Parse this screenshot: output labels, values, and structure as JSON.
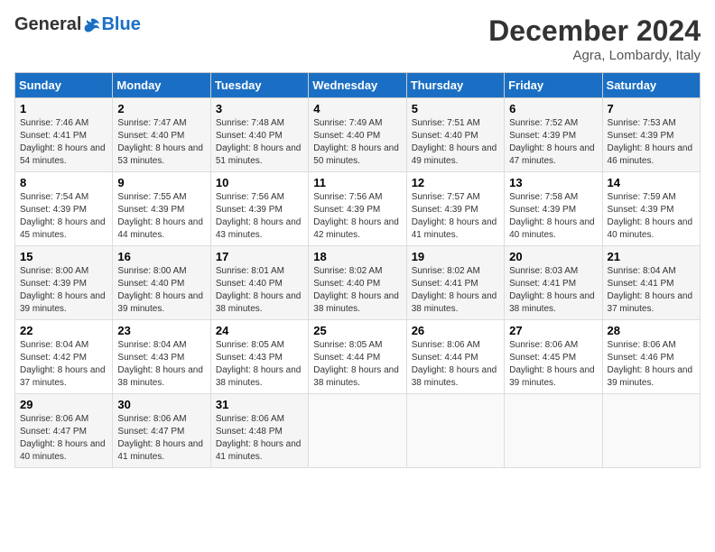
{
  "header": {
    "logo_general": "General",
    "logo_blue": "Blue",
    "month_title": "December 2024",
    "location": "Agra, Lombardy, Italy"
  },
  "days_of_week": [
    "Sunday",
    "Monday",
    "Tuesday",
    "Wednesday",
    "Thursday",
    "Friday",
    "Saturday"
  ],
  "weeks": [
    [
      {
        "day": "1",
        "sunrise": "7:46 AM",
        "sunset": "4:41 PM",
        "daylight": "8 hours and 54 minutes."
      },
      {
        "day": "2",
        "sunrise": "7:47 AM",
        "sunset": "4:40 PM",
        "daylight": "8 hours and 53 minutes."
      },
      {
        "day": "3",
        "sunrise": "7:48 AM",
        "sunset": "4:40 PM",
        "daylight": "8 hours and 51 minutes."
      },
      {
        "day": "4",
        "sunrise": "7:49 AM",
        "sunset": "4:40 PM",
        "daylight": "8 hours and 50 minutes."
      },
      {
        "day": "5",
        "sunrise": "7:51 AM",
        "sunset": "4:40 PM",
        "daylight": "8 hours and 49 minutes."
      },
      {
        "day": "6",
        "sunrise": "7:52 AM",
        "sunset": "4:39 PM",
        "daylight": "8 hours and 47 minutes."
      },
      {
        "day": "7",
        "sunrise": "7:53 AM",
        "sunset": "4:39 PM",
        "daylight": "8 hours and 46 minutes."
      }
    ],
    [
      {
        "day": "8",
        "sunrise": "7:54 AM",
        "sunset": "4:39 PM",
        "daylight": "8 hours and 45 minutes."
      },
      {
        "day": "9",
        "sunrise": "7:55 AM",
        "sunset": "4:39 PM",
        "daylight": "8 hours and 44 minutes."
      },
      {
        "day": "10",
        "sunrise": "7:56 AM",
        "sunset": "4:39 PM",
        "daylight": "8 hours and 43 minutes."
      },
      {
        "day": "11",
        "sunrise": "7:56 AM",
        "sunset": "4:39 PM",
        "daylight": "8 hours and 42 minutes."
      },
      {
        "day": "12",
        "sunrise": "7:57 AM",
        "sunset": "4:39 PM",
        "daylight": "8 hours and 41 minutes."
      },
      {
        "day": "13",
        "sunrise": "7:58 AM",
        "sunset": "4:39 PM",
        "daylight": "8 hours and 40 minutes."
      },
      {
        "day": "14",
        "sunrise": "7:59 AM",
        "sunset": "4:39 PM",
        "daylight": "8 hours and 40 minutes."
      }
    ],
    [
      {
        "day": "15",
        "sunrise": "8:00 AM",
        "sunset": "4:39 PM",
        "daylight": "8 hours and 39 minutes."
      },
      {
        "day": "16",
        "sunrise": "8:00 AM",
        "sunset": "4:40 PM",
        "daylight": "8 hours and 39 minutes."
      },
      {
        "day": "17",
        "sunrise": "8:01 AM",
        "sunset": "4:40 PM",
        "daylight": "8 hours and 38 minutes."
      },
      {
        "day": "18",
        "sunrise": "8:02 AM",
        "sunset": "4:40 PM",
        "daylight": "8 hours and 38 minutes."
      },
      {
        "day": "19",
        "sunrise": "8:02 AM",
        "sunset": "4:41 PM",
        "daylight": "8 hours and 38 minutes."
      },
      {
        "day": "20",
        "sunrise": "8:03 AM",
        "sunset": "4:41 PM",
        "daylight": "8 hours and 38 minutes."
      },
      {
        "day": "21",
        "sunrise": "8:04 AM",
        "sunset": "4:41 PM",
        "daylight": "8 hours and 37 minutes."
      }
    ],
    [
      {
        "day": "22",
        "sunrise": "8:04 AM",
        "sunset": "4:42 PM",
        "daylight": "8 hours and 37 minutes."
      },
      {
        "day": "23",
        "sunrise": "8:04 AM",
        "sunset": "4:43 PM",
        "daylight": "8 hours and 38 minutes."
      },
      {
        "day": "24",
        "sunrise": "8:05 AM",
        "sunset": "4:43 PM",
        "daylight": "8 hours and 38 minutes."
      },
      {
        "day": "25",
        "sunrise": "8:05 AM",
        "sunset": "4:44 PM",
        "daylight": "8 hours and 38 minutes."
      },
      {
        "day": "26",
        "sunrise": "8:06 AM",
        "sunset": "4:44 PM",
        "daylight": "8 hours and 38 minutes."
      },
      {
        "day": "27",
        "sunrise": "8:06 AM",
        "sunset": "4:45 PM",
        "daylight": "8 hours and 39 minutes."
      },
      {
        "day": "28",
        "sunrise": "8:06 AM",
        "sunset": "4:46 PM",
        "daylight": "8 hours and 39 minutes."
      }
    ],
    [
      {
        "day": "29",
        "sunrise": "8:06 AM",
        "sunset": "4:47 PM",
        "daylight": "8 hours and 40 minutes."
      },
      {
        "day": "30",
        "sunrise": "8:06 AM",
        "sunset": "4:47 PM",
        "daylight": "8 hours and 41 minutes."
      },
      {
        "day": "31",
        "sunrise": "8:06 AM",
        "sunset": "4:48 PM",
        "daylight": "8 hours and 41 minutes."
      },
      null,
      null,
      null,
      null
    ]
  ]
}
